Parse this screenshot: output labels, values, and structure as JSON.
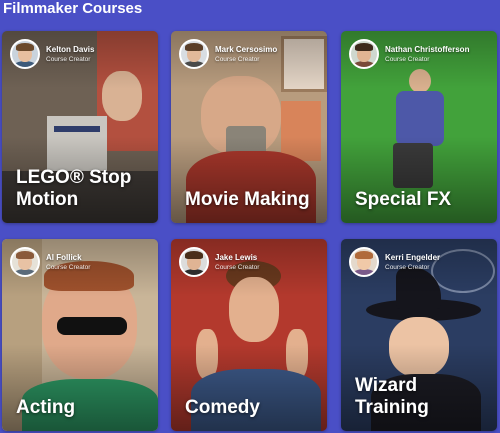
{
  "page": {
    "title": "Filmmaker Courses"
  },
  "courses": [
    {
      "title": "LEGO® Stop Motion",
      "creator": "Kelton Davis",
      "role": "Course Creator",
      "bg": "#7a6a5c",
      "accent": "#a23b2e"
    },
    {
      "title": "Movie Making",
      "creator": "Mark Cersosimo",
      "role": "Course Creator",
      "bg": "#b79a7c",
      "accent": "#c63d2f"
    },
    {
      "title": "Special FX",
      "creator": "Nathan Christofferson",
      "role": "Course Creator",
      "bg": "#3f9b3a",
      "accent": "#4c56a0"
    },
    {
      "title": "Acting",
      "creator": "Al Follick",
      "role": "Course Creator",
      "bg": "#c8b59a",
      "accent": "#2fa36a"
    },
    {
      "title": "Comedy",
      "creator": "Jake Lewis",
      "role": "Course Creator",
      "bg": "#b23a2e",
      "accent": "#2e4b7a"
    },
    {
      "title": "Wizard Training",
      "creator": "Kerri Engelder",
      "role": "Course Creator",
      "bg": "#2c3f66",
      "accent": "#1a1a22"
    }
  ]
}
